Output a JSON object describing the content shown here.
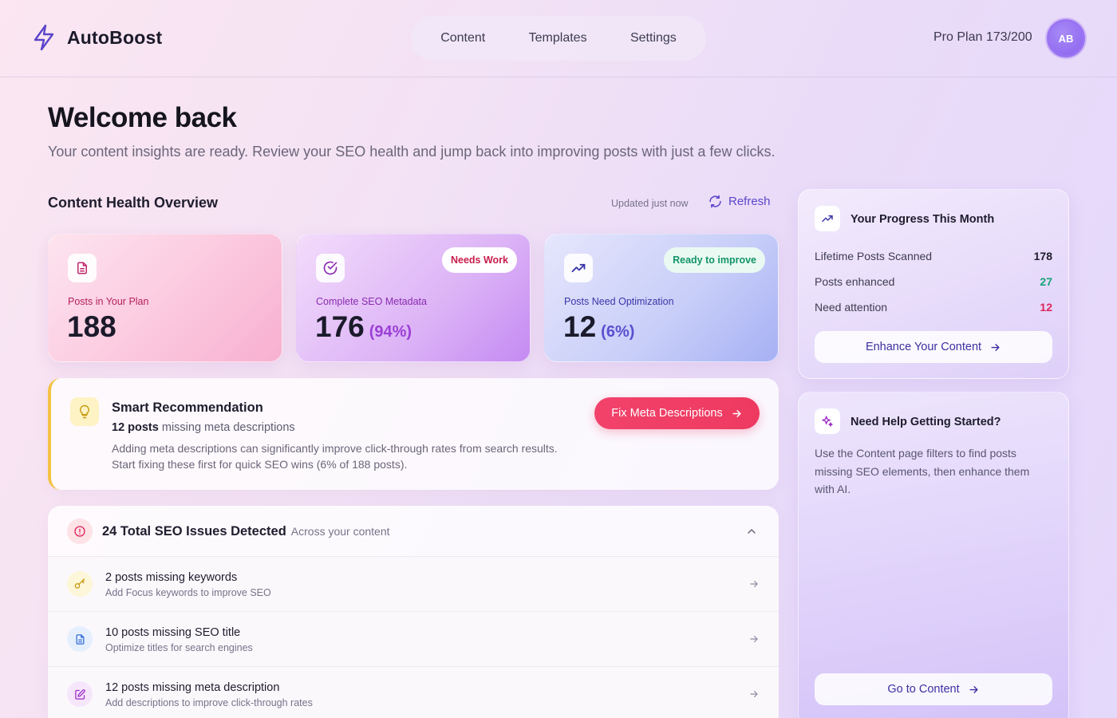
{
  "app": {
    "name": "AutoBoost",
    "plan_label": "Pro Plan 173/200",
    "avatar_initials": "AB",
    "accent_color": "#5b45c9"
  },
  "nav": {
    "items": [
      {
        "label": "Content"
      },
      {
        "label": "Templates"
      },
      {
        "label": "Settings"
      }
    ]
  },
  "welcome": {
    "title": "Welcome back",
    "subtitle": "Your content insights are ready. Review your SEO health and jump back into improving posts with just a few clicks."
  },
  "overview": {
    "title": "Content Health Overview",
    "updated": "Updated just now",
    "refresh_label": "Refresh"
  },
  "stats": [
    {
      "label": "Posts in Your Plan",
      "value": "188",
      "pct": "",
      "badge": "",
      "icon": "document-icon",
      "label_color": "#b5205a"
    },
    {
      "label": "Complete SEO Metadata",
      "value": "176",
      "pct": "(94%)",
      "badge": "Needs Work",
      "icon": "check-circle-icon",
      "label_color": "#8a2bb0",
      "pct_color": "#9b3fd6",
      "badge_color": "#c81d4c"
    },
    {
      "label": "Posts Need Optimization",
      "value": "12",
      "pct": "(6%)",
      "badge": "Ready to improve",
      "icon": "trending-up-icon",
      "label_color": "#3b35a8",
      "pct_color": "#5a4fd0",
      "badge_color": "#12946a"
    }
  ],
  "recommendation": {
    "title": "Smart Recommendation",
    "count_bold": "12 posts",
    "count_rest": " missing meta descriptions",
    "desc_line1": "Adding meta descriptions can significantly improve click-through rates from search results.",
    "desc_line2": "Start fixing these first for quick SEO wins (6% of 188 posts).",
    "button_label": "Fix Meta Descriptions",
    "icon": "lightbulb-icon"
  },
  "issues": {
    "title": "24 Total SEO Issues Detected",
    "subtitle": "Across your content",
    "rows": [
      {
        "title": "2 posts missing keywords",
        "desc": "Add Focus keywords to improve SEO",
        "icon": "key-icon"
      },
      {
        "title": "10 posts missing SEO title",
        "desc": "Optimize titles for search engines",
        "icon": "document-icon"
      },
      {
        "title": "12 posts missing meta description",
        "desc": "Add descriptions to improve click-through rates",
        "icon": "edit-icon"
      }
    ]
  },
  "progress": {
    "title": "Your Progress This Month",
    "rows": [
      {
        "label": "Lifetime Posts Scanned",
        "value": "178",
        "color": "#1f1d2e"
      },
      {
        "label": "Posts enhanced",
        "value": "27",
        "color": "#16a37a"
      },
      {
        "label": "Need attention",
        "value": "12",
        "color": "#e0245a"
      }
    ],
    "button_label": "Enhance Your Content"
  },
  "help": {
    "title": "Need Help Getting Started?",
    "text": "Use the Content page filters to find posts missing SEO elements, then enhance them with AI.",
    "button_label": "Go to Content",
    "icon": "sparkles-icon"
  }
}
